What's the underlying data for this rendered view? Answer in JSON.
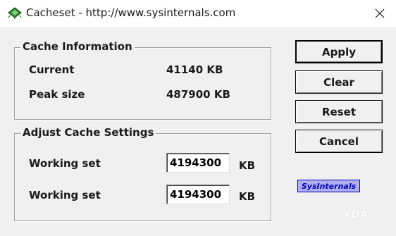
{
  "window": {
    "title": "Cacheset - http://www.sysinternals.com",
    "icon": "chip-icon"
  },
  "cache_info": {
    "group_label": "Cache Information",
    "current_label": "Current",
    "current_value": "41140 KB",
    "peak_label": "Peak size",
    "peak_value": "487900 KB"
  },
  "adjust": {
    "group_label": "Adjust Cache Settings",
    "min_label": "Working set",
    "min_value": "4194300",
    "min_unit": "KB",
    "max_label": "Working set",
    "max_value": "4194300",
    "max_unit": "KB"
  },
  "buttons": {
    "apply": "Apply",
    "clear": "Clear",
    "reset": "Reset",
    "cancel": "Cancel"
  },
  "brand": {
    "sysinternals": "SysInternals",
    "watermark": "XDA"
  },
  "colors": {
    "dialog_bg": "#f0f0f0",
    "brand_fill": "#b0b0f0",
    "brand_text": "#0000c0"
  }
}
